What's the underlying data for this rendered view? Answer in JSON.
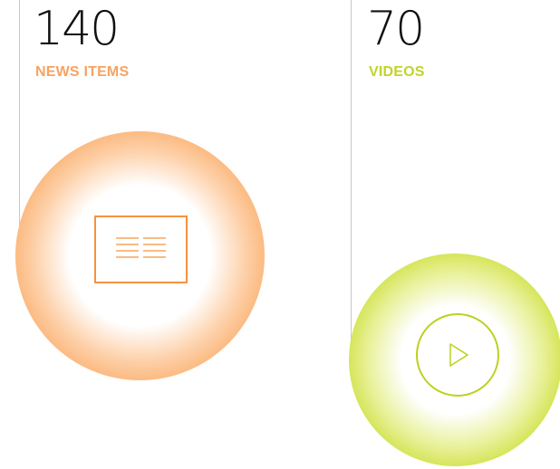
{
  "stats": [
    {
      "count": "140",
      "label": "NEWS ITEMS",
      "color": "#f7a262",
      "orb_color": "#f98a38",
      "icon": "newspaper-icon"
    },
    {
      "count": "70",
      "label": "VIDEOS",
      "color": "#c0d42b",
      "orb_color": "#b4cc11",
      "icon": "play-circle-icon"
    }
  ]
}
